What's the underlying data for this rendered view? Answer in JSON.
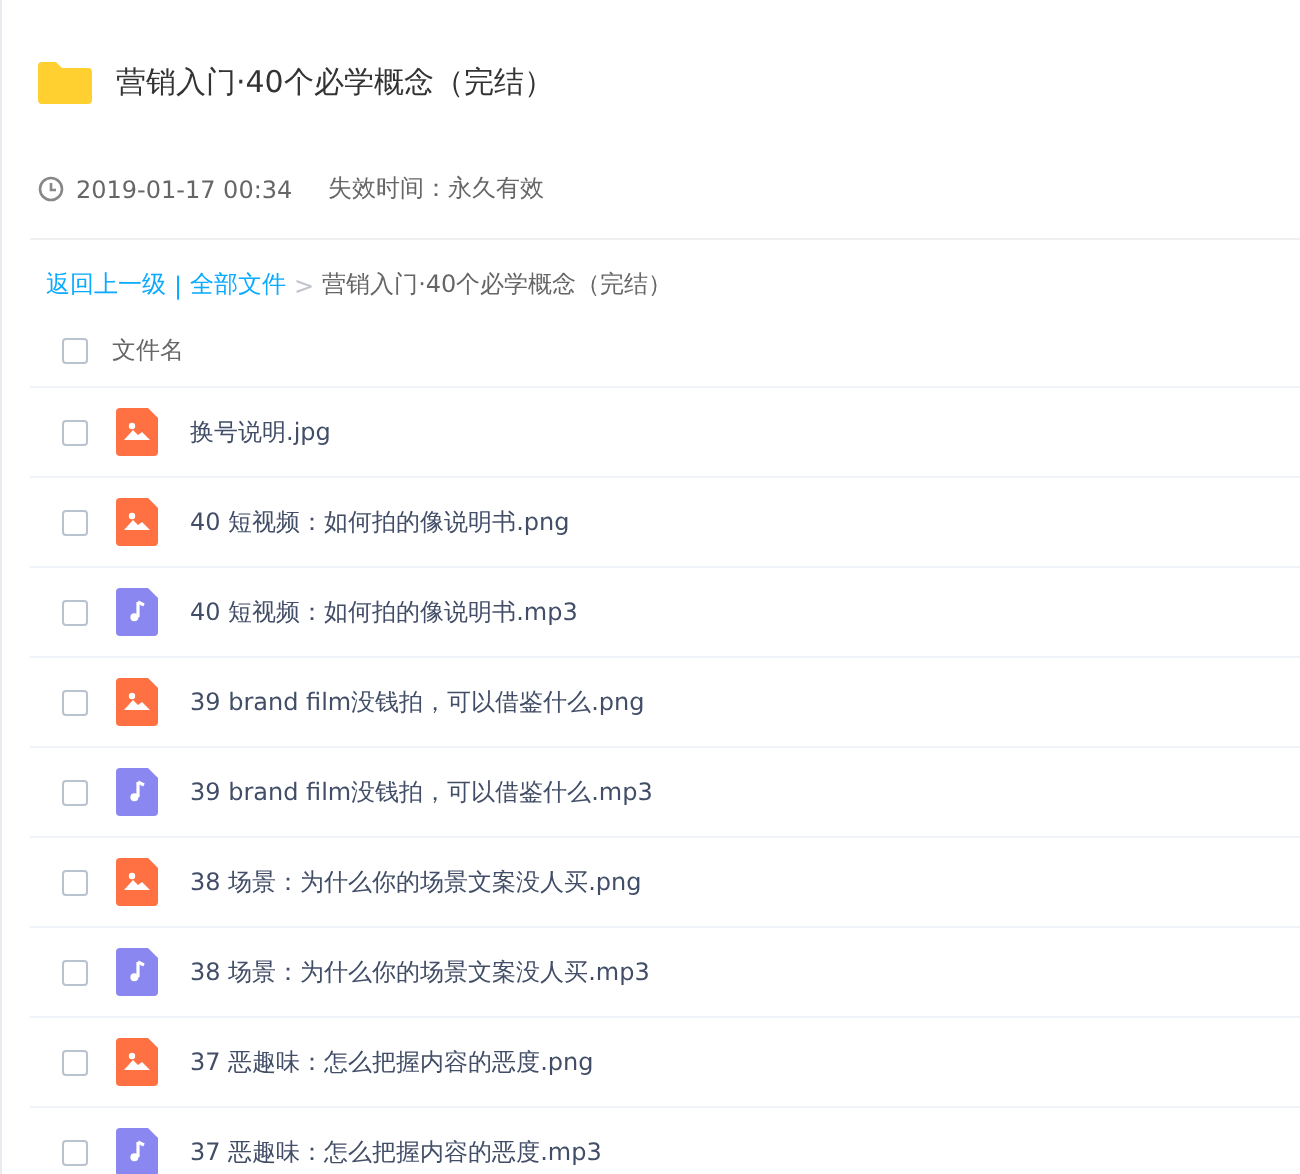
{
  "folder": {
    "title": "营销入门·40个必学概念（完结）",
    "date": "2019-01-17 00:34",
    "expiry": "失效时间：永久有效"
  },
  "breadcrumb": {
    "back": "返回上一级",
    "separator": "|",
    "root": "全部文件",
    "arrow": ">",
    "current": "营销入门·40个必学概念（完结）"
  },
  "table": {
    "header": {
      "label": "文件名",
      "checked": false
    },
    "rows": [
      {
        "name": "换号说明.jpg",
        "kind": "image",
        "checked": false
      },
      {
        "name": "40 短视频：如何拍的像说明书.png",
        "kind": "image",
        "checked": false
      },
      {
        "name": "40 短视频：如何拍的像说明书.mp3",
        "kind": "audio",
        "checked": false
      },
      {
        "name": "39 brand film没钱拍，可以借鉴什么.png",
        "kind": "image",
        "checked": false
      },
      {
        "name": "39 brand film没钱拍，可以借鉴什么.mp3",
        "kind": "audio",
        "checked": false
      },
      {
        "name": "38 场景：为什么你的场景文案没人买.png",
        "kind": "image",
        "checked": false
      },
      {
        "name": "38 场景：为什么你的场景文案没人买.mp3",
        "kind": "audio",
        "checked": false
      },
      {
        "name": "37 恶趣味：怎么把握内容的恶度.png",
        "kind": "image",
        "checked": false
      },
      {
        "name": "37 恶趣味：怎么把握内容的恶度.mp3",
        "kind": "audio",
        "checked": false
      }
    ]
  }
}
